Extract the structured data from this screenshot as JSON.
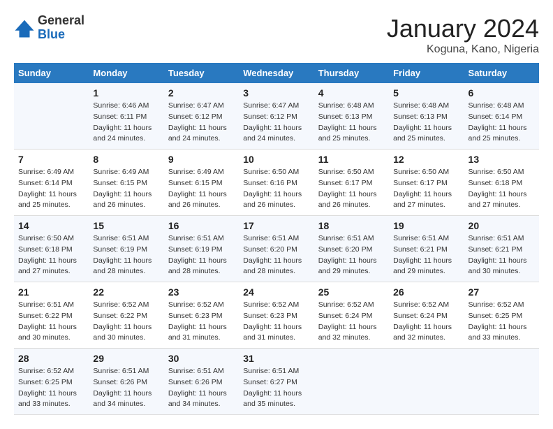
{
  "logo": {
    "general": "General",
    "blue": "Blue"
  },
  "title": "January 2024",
  "subtitle": "Koguna, Kano, Nigeria",
  "days_header": [
    "Sunday",
    "Monday",
    "Tuesday",
    "Wednesday",
    "Thursday",
    "Friday",
    "Saturday"
  ],
  "weeks": [
    [
      {
        "num": "",
        "sunrise": "",
        "sunset": "",
        "daylight": ""
      },
      {
        "num": "1",
        "sunrise": "Sunrise: 6:46 AM",
        "sunset": "Sunset: 6:11 PM",
        "daylight": "Daylight: 11 hours and 24 minutes."
      },
      {
        "num": "2",
        "sunrise": "Sunrise: 6:47 AM",
        "sunset": "Sunset: 6:12 PM",
        "daylight": "Daylight: 11 hours and 24 minutes."
      },
      {
        "num": "3",
        "sunrise": "Sunrise: 6:47 AM",
        "sunset": "Sunset: 6:12 PM",
        "daylight": "Daylight: 11 hours and 24 minutes."
      },
      {
        "num": "4",
        "sunrise": "Sunrise: 6:48 AM",
        "sunset": "Sunset: 6:13 PM",
        "daylight": "Daylight: 11 hours and 25 minutes."
      },
      {
        "num": "5",
        "sunrise": "Sunrise: 6:48 AM",
        "sunset": "Sunset: 6:13 PM",
        "daylight": "Daylight: 11 hours and 25 minutes."
      },
      {
        "num": "6",
        "sunrise": "Sunrise: 6:48 AM",
        "sunset": "Sunset: 6:14 PM",
        "daylight": "Daylight: 11 hours and 25 minutes."
      }
    ],
    [
      {
        "num": "7",
        "sunrise": "Sunrise: 6:49 AM",
        "sunset": "Sunset: 6:14 PM",
        "daylight": "Daylight: 11 hours and 25 minutes."
      },
      {
        "num": "8",
        "sunrise": "Sunrise: 6:49 AM",
        "sunset": "Sunset: 6:15 PM",
        "daylight": "Daylight: 11 hours and 26 minutes."
      },
      {
        "num": "9",
        "sunrise": "Sunrise: 6:49 AM",
        "sunset": "Sunset: 6:15 PM",
        "daylight": "Daylight: 11 hours and 26 minutes."
      },
      {
        "num": "10",
        "sunrise": "Sunrise: 6:50 AM",
        "sunset": "Sunset: 6:16 PM",
        "daylight": "Daylight: 11 hours and 26 minutes."
      },
      {
        "num": "11",
        "sunrise": "Sunrise: 6:50 AM",
        "sunset": "Sunset: 6:17 PM",
        "daylight": "Daylight: 11 hours and 26 minutes."
      },
      {
        "num": "12",
        "sunrise": "Sunrise: 6:50 AM",
        "sunset": "Sunset: 6:17 PM",
        "daylight": "Daylight: 11 hours and 27 minutes."
      },
      {
        "num": "13",
        "sunrise": "Sunrise: 6:50 AM",
        "sunset": "Sunset: 6:18 PM",
        "daylight": "Daylight: 11 hours and 27 minutes."
      }
    ],
    [
      {
        "num": "14",
        "sunrise": "Sunrise: 6:50 AM",
        "sunset": "Sunset: 6:18 PM",
        "daylight": "Daylight: 11 hours and 27 minutes."
      },
      {
        "num": "15",
        "sunrise": "Sunrise: 6:51 AM",
        "sunset": "Sunset: 6:19 PM",
        "daylight": "Daylight: 11 hours and 28 minutes."
      },
      {
        "num": "16",
        "sunrise": "Sunrise: 6:51 AM",
        "sunset": "Sunset: 6:19 PM",
        "daylight": "Daylight: 11 hours and 28 minutes."
      },
      {
        "num": "17",
        "sunrise": "Sunrise: 6:51 AM",
        "sunset": "Sunset: 6:20 PM",
        "daylight": "Daylight: 11 hours and 28 minutes."
      },
      {
        "num": "18",
        "sunrise": "Sunrise: 6:51 AM",
        "sunset": "Sunset: 6:20 PM",
        "daylight": "Daylight: 11 hours and 29 minutes."
      },
      {
        "num": "19",
        "sunrise": "Sunrise: 6:51 AM",
        "sunset": "Sunset: 6:21 PM",
        "daylight": "Daylight: 11 hours and 29 minutes."
      },
      {
        "num": "20",
        "sunrise": "Sunrise: 6:51 AM",
        "sunset": "Sunset: 6:21 PM",
        "daylight": "Daylight: 11 hours and 30 minutes."
      }
    ],
    [
      {
        "num": "21",
        "sunrise": "Sunrise: 6:51 AM",
        "sunset": "Sunset: 6:22 PM",
        "daylight": "Daylight: 11 hours and 30 minutes."
      },
      {
        "num": "22",
        "sunrise": "Sunrise: 6:52 AM",
        "sunset": "Sunset: 6:22 PM",
        "daylight": "Daylight: 11 hours and 30 minutes."
      },
      {
        "num": "23",
        "sunrise": "Sunrise: 6:52 AM",
        "sunset": "Sunset: 6:23 PM",
        "daylight": "Daylight: 11 hours and 31 minutes."
      },
      {
        "num": "24",
        "sunrise": "Sunrise: 6:52 AM",
        "sunset": "Sunset: 6:23 PM",
        "daylight": "Daylight: 11 hours and 31 minutes."
      },
      {
        "num": "25",
        "sunrise": "Sunrise: 6:52 AM",
        "sunset": "Sunset: 6:24 PM",
        "daylight": "Daylight: 11 hours and 32 minutes."
      },
      {
        "num": "26",
        "sunrise": "Sunrise: 6:52 AM",
        "sunset": "Sunset: 6:24 PM",
        "daylight": "Daylight: 11 hours and 32 minutes."
      },
      {
        "num": "27",
        "sunrise": "Sunrise: 6:52 AM",
        "sunset": "Sunset: 6:25 PM",
        "daylight": "Daylight: 11 hours and 33 minutes."
      }
    ],
    [
      {
        "num": "28",
        "sunrise": "Sunrise: 6:52 AM",
        "sunset": "Sunset: 6:25 PM",
        "daylight": "Daylight: 11 hours and 33 minutes."
      },
      {
        "num": "29",
        "sunrise": "Sunrise: 6:51 AM",
        "sunset": "Sunset: 6:26 PM",
        "daylight": "Daylight: 11 hours and 34 minutes."
      },
      {
        "num": "30",
        "sunrise": "Sunrise: 6:51 AM",
        "sunset": "Sunset: 6:26 PM",
        "daylight": "Daylight: 11 hours and 34 minutes."
      },
      {
        "num": "31",
        "sunrise": "Sunrise: 6:51 AM",
        "sunset": "Sunset: 6:27 PM",
        "daylight": "Daylight: 11 hours and 35 minutes."
      },
      {
        "num": "",
        "sunrise": "",
        "sunset": "",
        "daylight": ""
      },
      {
        "num": "",
        "sunrise": "",
        "sunset": "",
        "daylight": ""
      },
      {
        "num": "",
        "sunrise": "",
        "sunset": "",
        "daylight": ""
      }
    ]
  ]
}
